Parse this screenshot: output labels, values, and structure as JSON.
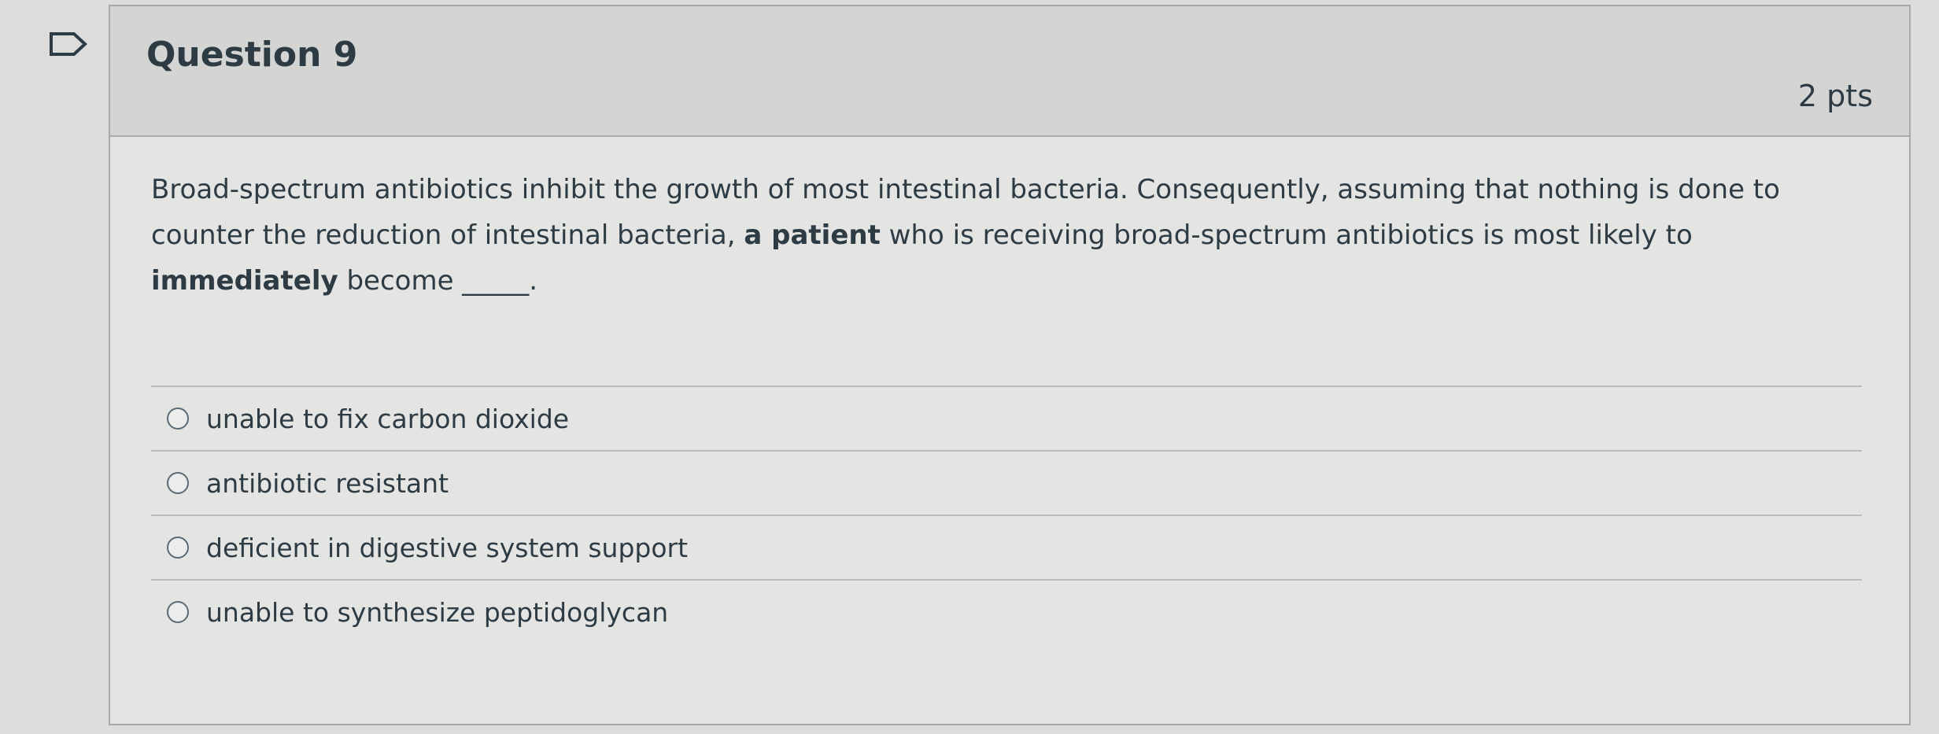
{
  "question": {
    "title": "Question 9",
    "points": "2 pts",
    "text_parts": [
      "Broad-spectrum antibiotics inhibit the growth of most intestinal bacteria. Consequently, assuming that nothing is done to counter the reduction of intestinal bacteria, ",
      "a patient",
      " who is receiving broad-spectrum antibiotics is most likely to ",
      "immediately",
      " become _____."
    ],
    "answers": [
      "unable to fix carbon dioxide",
      "antibiotic resistant",
      "deficient in digestive system support",
      "unable to synthesize peptidoglycan"
    ]
  },
  "icons": {
    "flag": "flag-icon",
    "radio": "radio-unselected-icon"
  },
  "colors": {
    "text": "#2d3b45",
    "border": "#a7aaab",
    "header_bg": "#d4d5d3"
  }
}
